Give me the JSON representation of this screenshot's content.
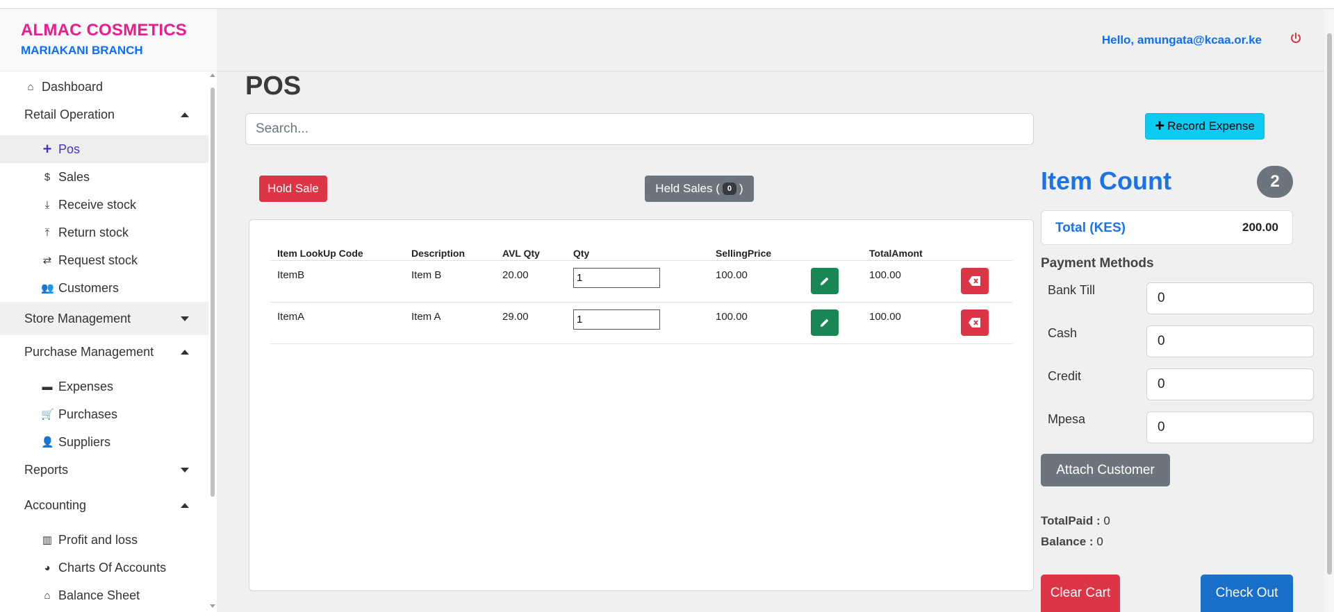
{
  "brand": {
    "title": "ALMAC COSMETICS",
    "branch": "MARIAKANI BRANCH"
  },
  "header": {
    "greeting": "Hello,  amungata@kcaa.or.ke"
  },
  "sidebar": {
    "dashboard": "Dashboard",
    "retail_operation": "Retail Operation",
    "pos": "Pos",
    "sales": "Sales",
    "receive_stock": "Receive stock",
    "return_stock": "Return stock",
    "request_stock": "Request stock",
    "customers": "Customers",
    "store_management": "Store Management",
    "purchase_management": "Purchase Management",
    "expenses": "Expenses",
    "purchases": "Purchases",
    "suppliers": "Suppliers",
    "reports": "Reports",
    "accounting": "Accounting",
    "profit_and_loss": "Profit and loss",
    "charts_of_accounts": "Charts Of Accounts",
    "balance_sheet": "Balance Sheet"
  },
  "main": {
    "page_title": "POS",
    "search_placeholder": "Search...",
    "record_expense": "Record Expense",
    "hold_sale": "Hold Sale",
    "held_sales_label": "Held Sales (",
    "held_sales_count": "0",
    "held_sales_close": ")"
  },
  "table": {
    "headers": [
      "Item LookUp Code",
      "Description",
      "AVL Qty",
      "Qty",
      "SellingPrice",
      "TotalAmont"
    ],
    "rows": [
      {
        "code": "ItemB",
        "description": "Item B",
        "avl_qty": "20.00",
        "qty": "1",
        "selling_price": "100.00",
        "total": "100.00"
      },
      {
        "code": "ItemA",
        "description": "Item A",
        "avl_qty": "29.00",
        "qty": "1",
        "selling_price": "100.00",
        "total": "100.00"
      }
    ]
  },
  "summary": {
    "item_count_label": "Item Count",
    "item_count": "2",
    "total_label": "Total (KES)",
    "total_value": "200.00",
    "payment_methods_title": "Payment Methods",
    "payment_methods": [
      {
        "label": "Bank Till",
        "value": "0"
      },
      {
        "label": "Cash",
        "value": "0"
      },
      {
        "label": "Credit",
        "value": "0"
      },
      {
        "label": "Mpesa",
        "value": "0"
      }
    ],
    "attach_customer": "Attach Customer",
    "total_paid_label": "TotalPaid :",
    "total_paid_value": "0",
    "balance_label": "Balance :",
    "balance_value": "0",
    "clear_cart": "Clear Cart",
    "check_out": "Check Out"
  },
  "colors": {
    "brand_pink": "#e91e8c",
    "primary_blue": "#0d6efd",
    "danger": "#dc3545",
    "success": "#198754",
    "info": "#0dcaf0",
    "secondary": "#6c757d"
  },
  "icons": {
    "dashboard": "home-icon",
    "pos": "plus-icon",
    "sales": "dollar-icon",
    "receive": "download-icon",
    "return": "upload-icon",
    "request": "swap-icon",
    "customers": "users-icon",
    "expenses": "credit-card-icon",
    "purchases": "cart-icon",
    "suppliers": "user-icon",
    "profit": "bar-chart-icon",
    "charts": "pie-chart-icon",
    "balance": "bank-icon",
    "power": "power-icon",
    "edit": "pencil-icon",
    "delete": "backspace-icon"
  }
}
